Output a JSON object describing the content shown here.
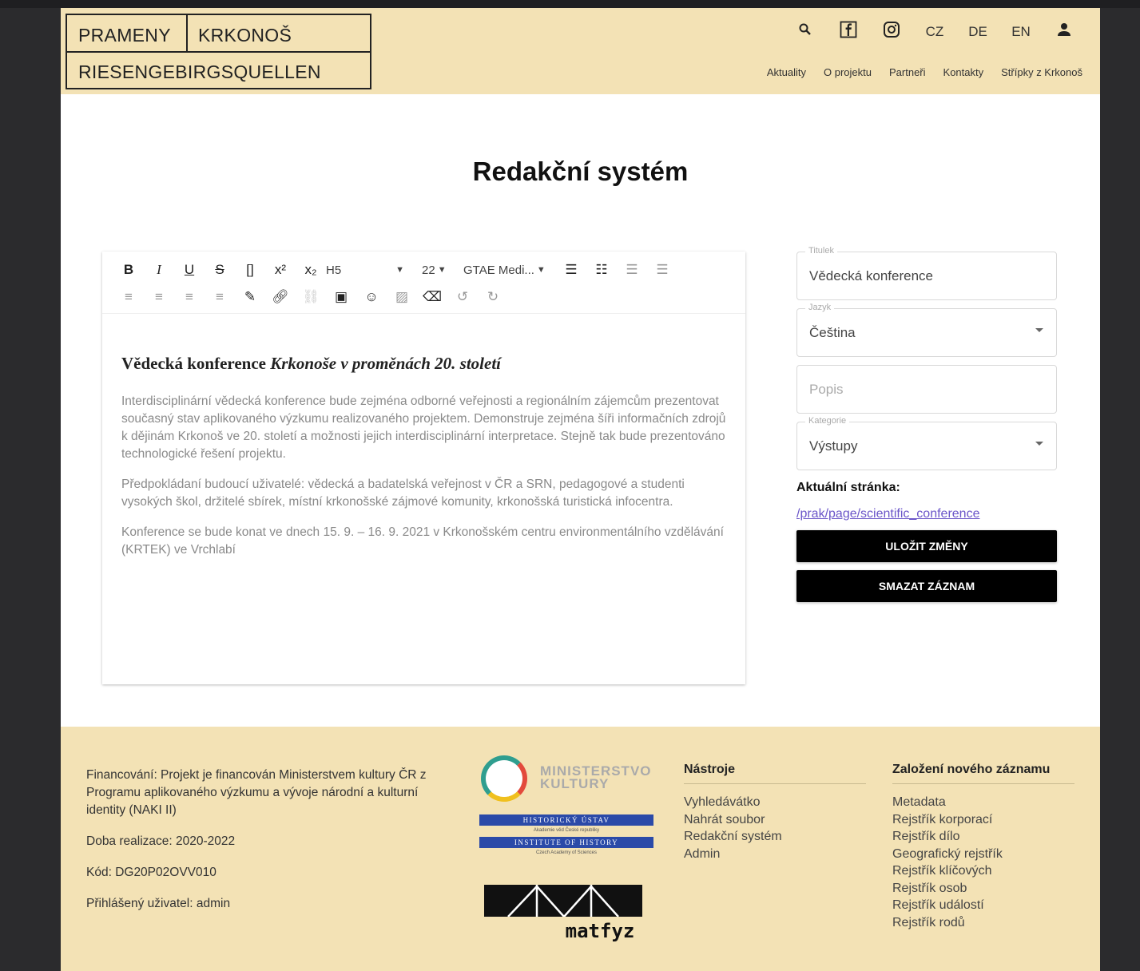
{
  "header": {
    "logo": {
      "word1": "PRAMENY",
      "word2": "KRKONOŠ",
      "word3": "RIESENGEBIRGSQUELLEN"
    },
    "langs": [
      "CZ",
      "DE",
      "EN"
    ],
    "nav": [
      "Aktuality",
      "O projektu",
      "Partneři",
      "Kontakty",
      "Střípky z Krkonoš"
    ]
  },
  "page_title": "Redakční systém",
  "toolbar": {
    "heading_select": "H5",
    "size_select": "22",
    "font_select": "GTAE Medi..."
  },
  "content": {
    "heading_plain": "Vědecká konference ",
    "heading_italic": "Krkonoše v proměnách 20. století",
    "paragraphs": [
      "Interdisciplinární vědecká konference bude zejména odborné veřejnosti a regionálním zájemcům prezentovat současný stav aplikovaného výzkumu realizovaného projektem. Demonstruje zejména šíři informačních zdrojů k dějinám Krkonoš ve 20. století a možnosti jejich interdisciplinární interpretace. Stejně tak bude prezentováno technologické řešení projektu.",
      "Předpokládaní budoucí uživatelé: vědecká a badatelská veřejnost v ČR a SRN, pedagogové a studenti vysokých škol, držitelé sbírek, místní krkonošské zájmové komunity, krkonošská turistická infocentra.",
      "Konference se bude konat ve dnech 15. 9. – 16. 9. 2021 v Krkonošském centru environmentálního vzdělávání (KRTEK) ve Vrchlabí"
    ]
  },
  "form": {
    "title_label": "Titulek",
    "title_value": "Vědecká konference",
    "lang_label": "Jazyk",
    "lang_value": "Čeština",
    "desc_placeholder": "Popis",
    "cat_label": "Kategorie",
    "cat_value": "Výstupy",
    "current_page_label": "Aktuální stránka:",
    "current_page_link": "/prak/page/scientific_conference",
    "save_button": "ULOŽIT ZMĚNY",
    "delete_button": "SMAZAT ZÁZNAM"
  },
  "footer": {
    "funding": "Financování: Projekt je financován Ministerstvem kultury ČR z Programu aplikovaného výzkumu a vývoje národní a kulturní identity (NAKI II)",
    "period": "Doba realizace: 2020-2022",
    "code": "Kód: DG20P02OVV010",
    "user": "Přihlášený uživatel: admin",
    "logos": {
      "mk_line1": "MINISTERSTVO",
      "mk_line2": "KULTURY",
      "hu_top": "HISTORICKÝ ÚSTAV",
      "hu_mid": "Akademie věd České republiky",
      "hu_bottom": "INSTITUTE OF HISTORY",
      "hu_small": "Czech Academy of Sciences",
      "mf_text": "matfyz"
    },
    "tools_title": "Nástroje",
    "tools": [
      "Vyhledávátko",
      "Nahrát soubor",
      "Redakční systém",
      "Admin"
    ],
    "new_title": "Založení nového záznamu",
    "new_items": [
      "Metadata",
      "Rejstřík korporací",
      "Rejstřík dílo",
      "Geografický rejstřík",
      "Rejstřík klíčových",
      "Rejstřík osob",
      "Rejstřík událostí",
      "Rejstřík rodů"
    ]
  }
}
